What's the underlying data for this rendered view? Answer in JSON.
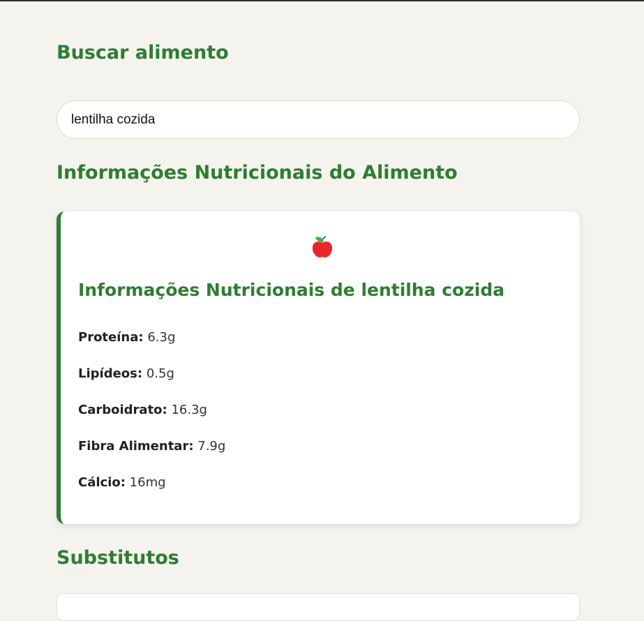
{
  "search": {
    "heading": "Buscar alimento",
    "value": "lentilha cozida"
  },
  "info": {
    "heading": "Informações Nutricionais do Alimento"
  },
  "card": {
    "icon": "apple-icon",
    "title": "Informações Nutricionais de lentilha cozida",
    "nutrients": [
      {
        "label": "Proteína:",
        "value": "6.3g"
      },
      {
        "label": "Lipídeos:",
        "value": "0.5g"
      },
      {
        "label": "Carboidrato:",
        "value": "16.3g"
      },
      {
        "label": "Fibra Alimentar:",
        "value": "7.9g"
      },
      {
        "label": "Cálcio:",
        "value": "16mg"
      }
    ]
  },
  "substitutes": {
    "heading": "Substitutos"
  },
  "colors": {
    "accent": "#2e7d32",
    "background": "#f5f3ee"
  }
}
